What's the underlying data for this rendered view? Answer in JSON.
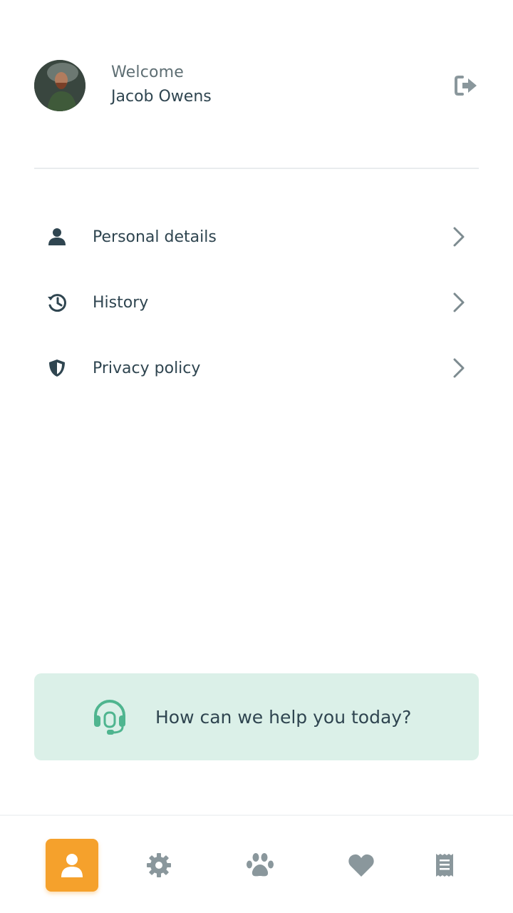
{
  "header": {
    "welcome": "Welcome",
    "user_name": "Jacob Owens"
  },
  "menu": {
    "items": [
      {
        "label": "Personal details",
        "icon": "person-icon"
      },
      {
        "label": "History",
        "icon": "history-icon"
      },
      {
        "label": "Privacy policy",
        "icon": "shield-icon"
      }
    ]
  },
  "help": {
    "text": "How can we help you today?",
    "icon": "headset-icon"
  },
  "bottom_nav": {
    "items": [
      {
        "name": "profile",
        "icon": "person-icon",
        "active": true
      },
      {
        "name": "settings",
        "icon": "gear-icon",
        "active": false
      },
      {
        "name": "pets",
        "icon": "paw-icon",
        "active": false
      },
      {
        "name": "favorites",
        "icon": "heart-icon",
        "active": false
      },
      {
        "name": "receipts",
        "icon": "receipt-icon",
        "active": false
      }
    ]
  },
  "colors": {
    "accent": "#f5a12c",
    "help_bg": "#dbf0e8",
    "help_icon": "#4fb58f",
    "text": "#2f4550",
    "muted_icon": "#8a979c"
  }
}
